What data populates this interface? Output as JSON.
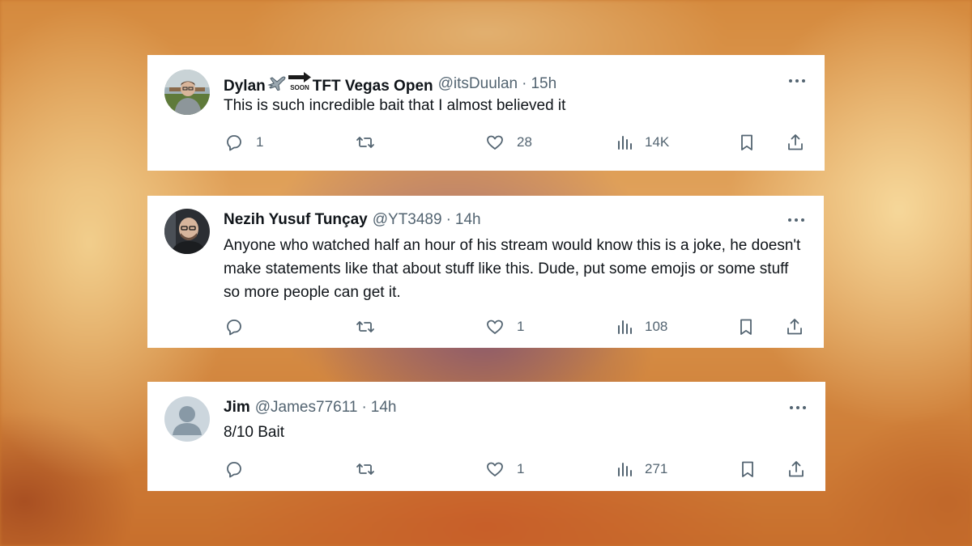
{
  "replies": [
    {
      "name_prefix": "Dylan",
      "name_emojis": [
        "airplane-emoji",
        "soon-arrow-emoji"
      ],
      "name_suffix": "TFT Vegas Open",
      "handle": "@itsDuulan",
      "separator": "·",
      "time": "15h",
      "text": "This is such incredible bait that I almost believed it",
      "reply_count": "1",
      "retweet_count": "",
      "like_count": "28",
      "view_count": "14K",
      "soon_label": "SOON"
    },
    {
      "name": "Nezih Yusuf Tunçay",
      "handle": "@YT3489",
      "separator": "·",
      "time": "14h",
      "text": "Anyone who watched half an hour of his stream would know this is a joke, he doesn't make statements like that about stuff like this. Dude, put some emojis or some stuff so more people can get it.",
      "reply_count": "",
      "retweet_count": "",
      "like_count": "1",
      "view_count": "108"
    },
    {
      "name": "Jim",
      "handle": "@James77611",
      "separator": "·",
      "time": "14h",
      "text": "8/10 Bait",
      "reply_count": "",
      "retweet_count": "",
      "like_count": "1",
      "view_count": "271"
    }
  ],
  "icons": {
    "reply": "reply-icon",
    "retweet": "retweet-icon",
    "like": "heart-icon",
    "views": "views-icon",
    "bookmark": "bookmark-icon",
    "share": "share-icon",
    "more": "more-dots-icon"
  },
  "colors": {
    "text": "#0f1419",
    "secondary": "#536471",
    "card": "#ffffff"
  }
}
